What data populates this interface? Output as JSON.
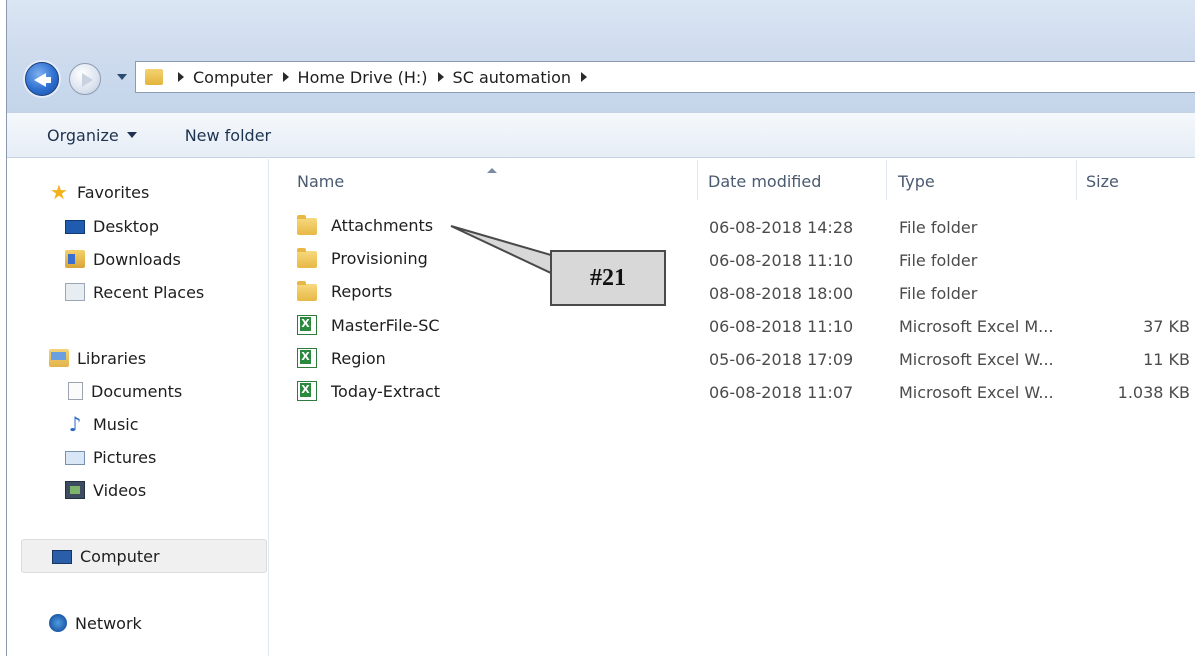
{
  "address": {
    "crumbs": [
      "Computer",
      "Home Drive (H:)",
      "SC automation"
    ]
  },
  "toolbar": {
    "organize_label": "Organize",
    "new_folder_label": "New folder"
  },
  "nav": {
    "favorites": "Favorites",
    "desktop": "Desktop",
    "downloads": "Downloads",
    "recent_places": "Recent Places",
    "libraries": "Libraries",
    "documents": "Documents",
    "music": "Music",
    "pictures": "Pictures",
    "videos": "Videos",
    "computer": "Computer",
    "network": "Network"
  },
  "columns": {
    "name": "Name",
    "date_modified": "Date modified",
    "type": "Type",
    "size": "Size"
  },
  "files": [
    {
      "name": "Attachments",
      "date": "06-08-2018 14:28",
      "type": "File folder",
      "size": "",
      "icon": "folder-icon"
    },
    {
      "name": "Provisioning",
      "date": "06-08-2018 11:10",
      "type": "File folder",
      "size": "",
      "icon": "folder-icon"
    },
    {
      "name": "Reports",
      "date": "08-08-2018 18:00",
      "type": "File folder",
      "size": "",
      "icon": "folder-icon"
    },
    {
      "name": "MasterFile-SC",
      "date": "06-08-2018 11:10",
      "type": "Microsoft Excel M...",
      "size": "37 KB",
      "icon": "excel-icon"
    },
    {
      "name": "Region",
      "date": "05-06-2018 17:09",
      "type": "Microsoft Excel W...",
      "size": "11 KB",
      "icon": "excel-icon"
    },
    {
      "name": "Today-Extract",
      "date": "06-08-2018 11:07",
      "type": "Microsoft Excel W...",
      "size": "1.038 KB",
      "icon": "excel-icon"
    }
  ],
  "callout": {
    "label": "#21"
  }
}
